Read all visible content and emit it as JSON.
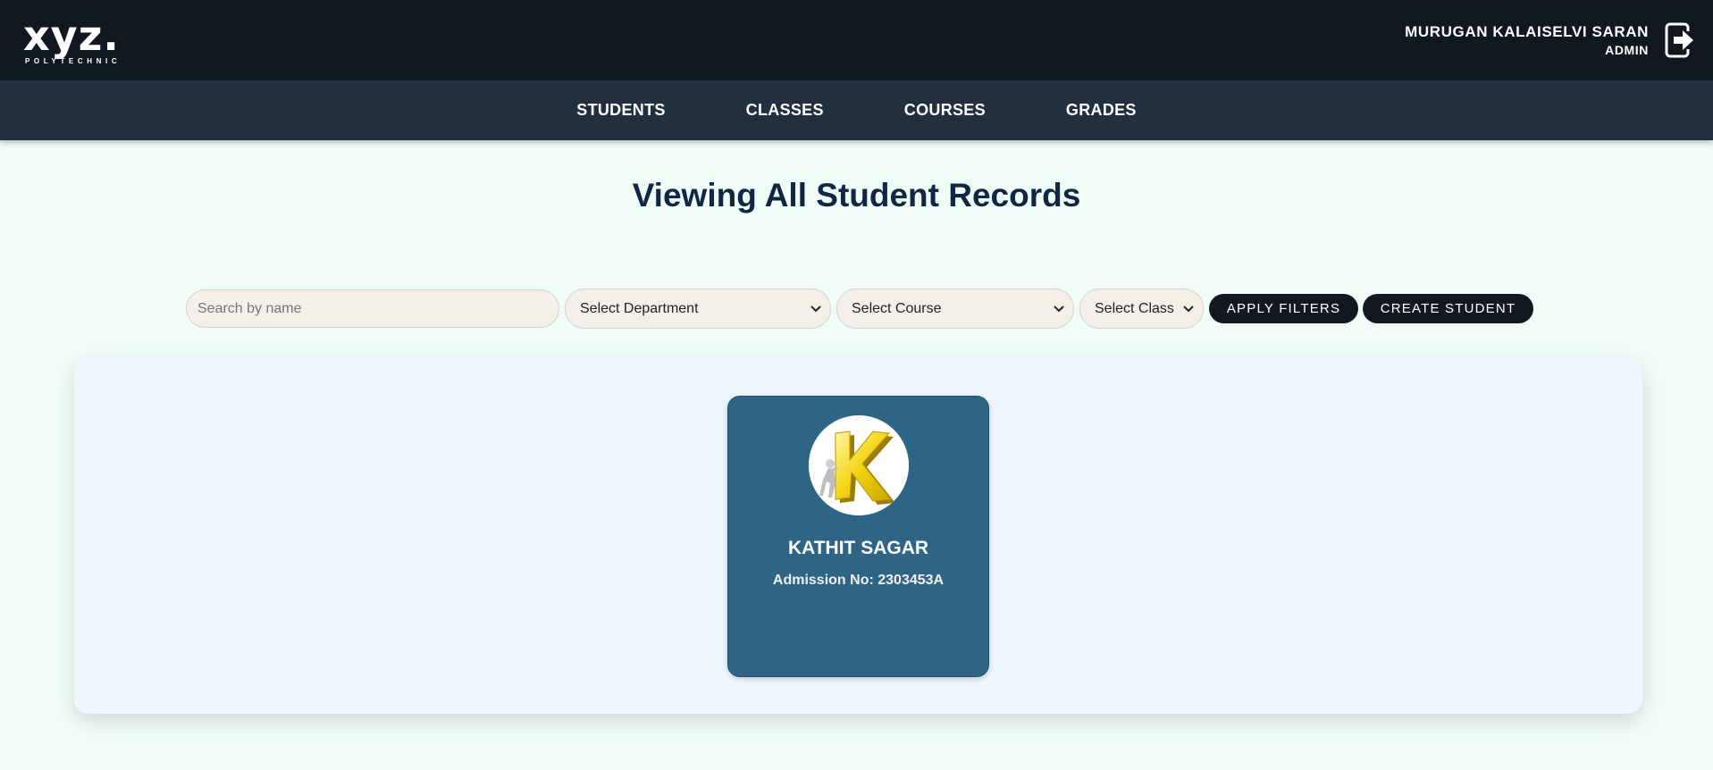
{
  "header": {
    "logo_text": "xyz.",
    "logo_subtitle": "POLYTECHNIC",
    "user_name": "MURUGAN KALAISELVI SARAN",
    "user_role": "ADMIN",
    "logout_icon": "logout-icon"
  },
  "nav": {
    "items": [
      {
        "label": "STUDENTS"
      },
      {
        "label": "CLASSES"
      },
      {
        "label": "COURSES"
      },
      {
        "label": "GRADES"
      }
    ]
  },
  "page": {
    "title": "Viewing All Student Records"
  },
  "filters": {
    "search_placeholder": "Search by name",
    "department": "Select Department",
    "course": "Select Course",
    "class": "Select Class",
    "apply_label": "APPLY FILTERS",
    "create_label": "CREATE STUDENT"
  },
  "students": [
    {
      "name": "KATHIT SAGAR",
      "admission": "Admission No: 2303453A",
      "avatar_icon": "letter-k-avatar"
    }
  ],
  "colors": {
    "header_bg": "#111820",
    "nav_bg": "#222f3e",
    "page_bg": "#f0fdf7",
    "title": "#0f2744",
    "card_bg": "#2e6586",
    "button_bg": "#111820"
  }
}
